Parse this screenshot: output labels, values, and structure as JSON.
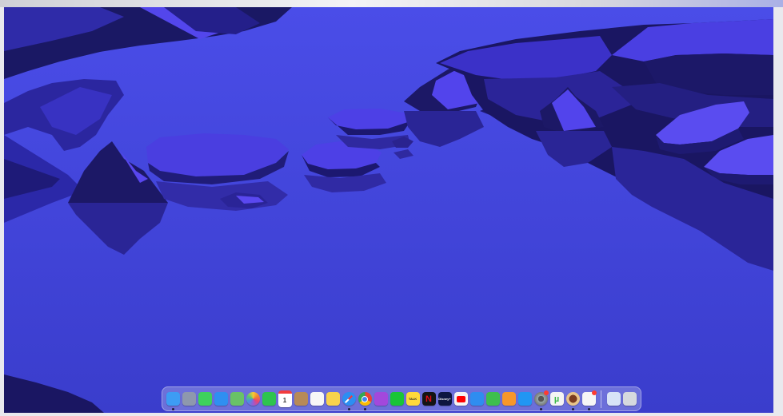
{
  "screen": {
    "wallpaper": "macOS Catalina dark-blue island illustration",
    "colors": {
      "sky": "#4a4de8",
      "water": "#3c3fd4",
      "rock_dark": "#1c1a6a",
      "rock_shadow": "#14124f",
      "rock_light": "#5c4ef0",
      "rock_mid": "#2d25a8"
    }
  },
  "dock": {
    "apps": [
      {
        "name": "Finder",
        "icon": "finder-icon",
        "color": "#3d9cf4",
        "running": true
      },
      {
        "name": "Launchpad",
        "icon": "launchpad-icon",
        "color": "#8e98ad",
        "running": false
      },
      {
        "name": "Messages",
        "icon": "messages-icon",
        "color": "#3ed15c",
        "running": false
      },
      {
        "name": "Mail",
        "icon": "mail-icon",
        "color": "#2f8ff1",
        "running": false
      },
      {
        "name": "Maps",
        "icon": "maps-icon",
        "color": "#69c267",
        "running": false
      },
      {
        "name": "Photos",
        "icon": "photos-icon",
        "color": "#f4f4f4",
        "running": false
      },
      {
        "name": "FaceTime",
        "icon": "facetime-icon",
        "color": "#2ec44f",
        "running": false
      },
      {
        "name": "Calendar",
        "icon": "calendar-icon",
        "color": "#ffffff",
        "running": false,
        "text": "1"
      },
      {
        "name": "Contacts",
        "icon": "contacts-icon",
        "color": "#b78a57",
        "running": false
      },
      {
        "name": "Reminders",
        "icon": "reminders-icon",
        "color": "#f7f7f7",
        "running": false
      },
      {
        "name": "Notes",
        "icon": "notes-icon",
        "color": "#f8d24c",
        "running": false
      },
      {
        "name": "Safari",
        "icon": "safari-icon",
        "color": "#2c8ef2",
        "running": true
      },
      {
        "name": "Google Chrome",
        "icon": "chrome-icon",
        "color": "#ffffff",
        "running": true
      },
      {
        "name": "Podcasts",
        "icon": "podcasts-icon",
        "color": "#a348dc",
        "running": false
      },
      {
        "name": "LINE",
        "icon": "line-icon",
        "color": "#19c538",
        "running": false
      },
      {
        "name": "KakaoTalk",
        "icon": "kakaotalk-icon",
        "color": "#ffd93a",
        "running": false,
        "text": "TALK"
      },
      {
        "name": "Netflix",
        "icon": "netflix-icon",
        "color": "#141414",
        "running": false,
        "text": "N"
      },
      {
        "name": "Disney+",
        "icon": "disney-plus-icon",
        "color": "#0d1640",
        "running": false,
        "text": "Disney+"
      },
      {
        "name": "YouTube",
        "icon": "youtube-icon",
        "color": "#f4f4f4",
        "running": false
      },
      {
        "name": "Keynote",
        "icon": "keynote-icon",
        "color": "#2f8df0",
        "running": false
      },
      {
        "name": "Numbers",
        "icon": "numbers-icon",
        "color": "#3ebf4d",
        "running": false
      },
      {
        "name": "Pages",
        "icon": "pages-icon",
        "color": "#f7972b",
        "running": false
      },
      {
        "name": "App Store",
        "icon": "app-store-icon",
        "color": "#2196f3",
        "running": false
      },
      {
        "name": "System Preferences",
        "icon": "system-preferences-icon",
        "color": "#8a8d94",
        "running": true,
        "badge": true
      },
      {
        "name": "uTorrent",
        "icon": "utorrent-icon",
        "color": "#f4f4f4",
        "running": false,
        "text": "µ"
      },
      {
        "name": "Noodle App",
        "icon": "noodle-icon",
        "color": "#c6a06b",
        "running": true
      },
      {
        "name": "Color Picker",
        "icon": "color-picker-icon",
        "color": "#f6f6f6",
        "running": true,
        "badge": true
      }
    ],
    "right": [
      {
        "name": "Downloads",
        "icon": "document-stack-icon",
        "color": "#d8e4f7"
      },
      {
        "name": "Trash",
        "icon": "trash-icon",
        "color": "#d6d9de"
      }
    ]
  }
}
